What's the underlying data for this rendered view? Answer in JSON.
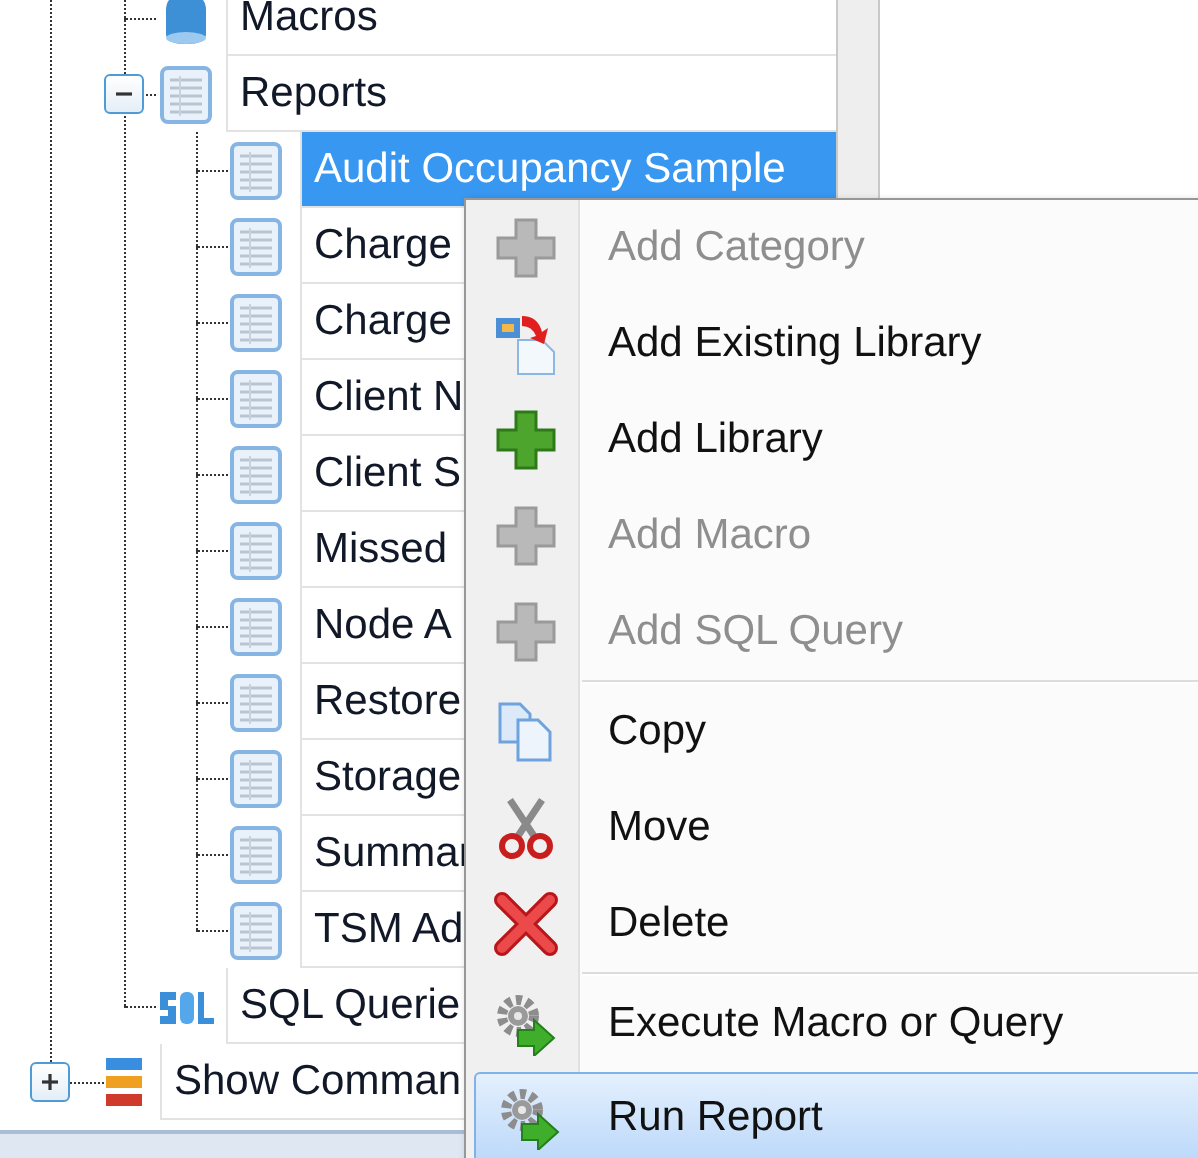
{
  "tree": {
    "branch": [
      {
        "kind": "macro",
        "label": "Macros"
      },
      {
        "kind": "report",
        "label": "Reports",
        "expanded": true,
        "children": [
          {
            "label": "Audit Occupancy Sample",
            "selected": true
          },
          {
            "label": "Charge",
            "selected": false
          },
          {
            "label": "Charge",
            "selected": false
          },
          {
            "label": "Client N",
            "selected": false
          },
          {
            "label": "Client S",
            "selected": false
          },
          {
            "label": "Missed",
            "selected": false
          },
          {
            "label": "Node A",
            "selected": false
          },
          {
            "label": "Restore",
            "selected": false
          },
          {
            "label": "Storage",
            "selected": false
          },
          {
            "label": "Summar",
            "selected": false
          },
          {
            "label": "TSM Ad",
            "selected": false
          }
        ]
      },
      {
        "kind": "sql",
        "label": "SQL Querie"
      }
    ],
    "nodes": [
      {
        "kind": "command",
        "label": "Show Comman",
        "expanded": false
      }
    ]
  },
  "context_menu": {
    "groups": [
      [
        {
          "label": "Add Category",
          "disabled": true,
          "selected": false
        },
        {
          "label": "Add Existing Library",
          "disabled": false,
          "selected": false
        },
        {
          "label": "Add Library",
          "disabled": false,
          "selected": false
        },
        {
          "label": "Add Macro",
          "disabled": true,
          "selected": false
        },
        {
          "label": "Add SQL Query",
          "disabled": true,
          "selected": false
        }
      ],
      [
        {
          "label": "Copy",
          "disabled": false,
          "selected": false
        },
        {
          "label": "Move",
          "disabled": false,
          "selected": false
        },
        {
          "label": "Delete",
          "disabled": false,
          "selected": false
        }
      ],
      [
        {
          "label": "Execute Macro or Query",
          "disabled": false,
          "selected": false
        },
        {
          "label": "Run Report",
          "disabled": false,
          "selected": true
        }
      ]
    ]
  }
}
